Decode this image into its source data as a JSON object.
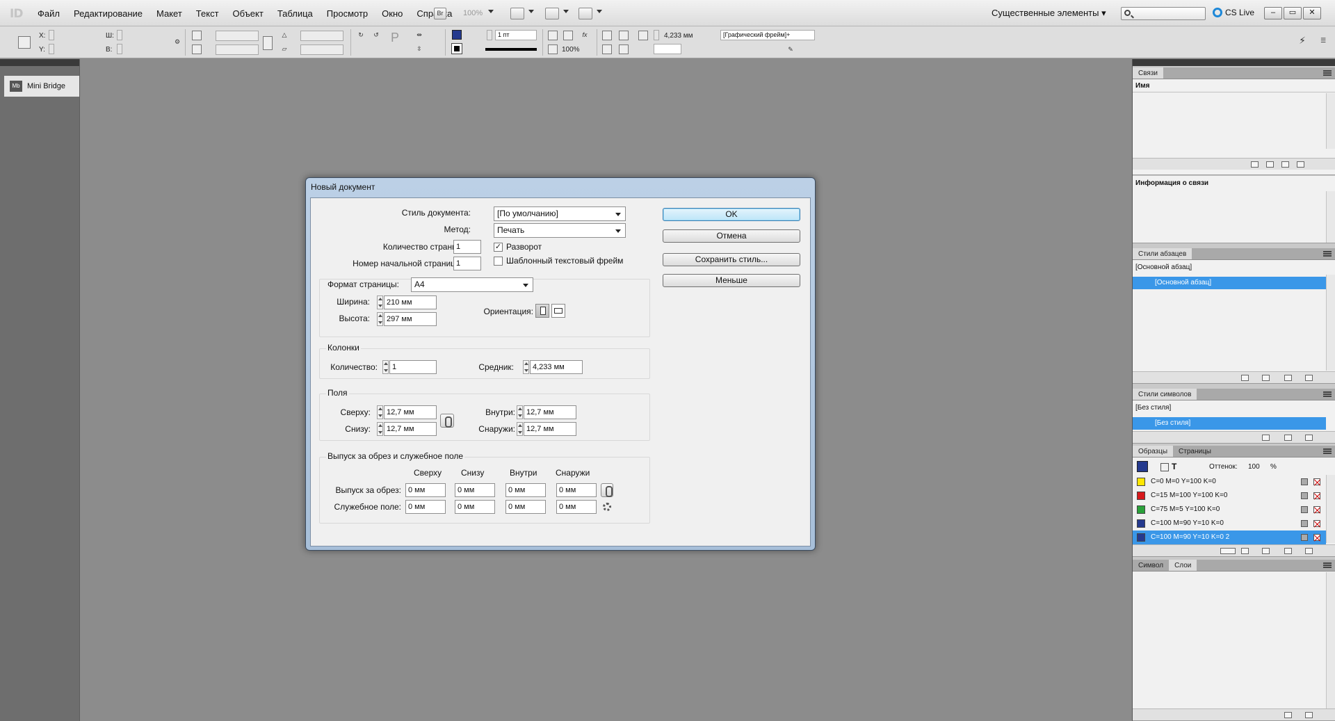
{
  "app": {
    "logo": "ID",
    "menus": [
      "Файл",
      "Редактирование",
      "Макет",
      "Текст",
      "Объект",
      "Таблица",
      "Просмотр",
      "Окно",
      "Справка"
    ],
    "bridge_button": "Br",
    "zoom": "100%",
    "workspace": "Существенные элементы",
    "cs_live": "CS Live",
    "window_buttons": [
      "–",
      "▭",
      "✕"
    ]
  },
  "controlbar": {
    "x_label": "X:",
    "y_label": "Y:",
    "w_label": "Ш:",
    "h_label": "В:",
    "stroke_weight": "1 пт",
    "dimension": "4,233 мм",
    "opacity": "100%",
    "frame_style": "[Графический фрейм]+"
  },
  "left_dock": {
    "mini_bridge_badge": "Mb",
    "mini_bridge_label": "Mini Bridge"
  },
  "links_panel": {
    "tab": "Связи",
    "col_name": "Имя",
    "info_title": "Информация о связи"
  },
  "para_styles": {
    "tab": "Стили абзацев",
    "current": "[Основной абзац]",
    "selected_item": "[Основной абзац]"
  },
  "char_styles": {
    "tab": "Стили символов",
    "current": "[Без стиля]",
    "selected_item": "[Без стиля]"
  },
  "swatches": {
    "tabs": [
      "Образцы",
      "Страницы"
    ],
    "tint_label": "Оттенок:",
    "tint_value": "100",
    "tint_unit": "%",
    "items": [
      {
        "name": "C=0 M=0 Y=100 K=0",
        "color": "#ffe600"
      },
      {
        "name": "C=15 M=100 Y=100 K=0",
        "color": "#d7191c"
      },
      {
        "name": "C=75 M=5 Y=100 K=0",
        "color": "#2aa13a"
      },
      {
        "name": "C=100 M=90 Y=10 K=0",
        "color": "#253a8e"
      },
      {
        "name": "C=100 M=90 Y=10 K=0 2",
        "color": "#253a8e"
      }
    ]
  },
  "layers_panel": {
    "tabs": [
      "Символ",
      "Слои"
    ]
  },
  "dialog": {
    "title": "Новый документ",
    "doc_style_label": "Стиль документа:",
    "doc_style_value": "[По умолчанию]",
    "intent_label": "Метод:",
    "intent_value": "Печать",
    "pages_label": "Количество страниц:",
    "pages_value": "1",
    "start_page_label": "Номер начальной страницы:",
    "start_page_value": "1",
    "facing_pages_label": "Разворот",
    "facing_pages_checked": "✓",
    "primary_frame_label": "Шаблонный текстовый фрейм",
    "page_size_label": "Формат страницы:",
    "page_size_value": "A4",
    "width_label": "Ширина:",
    "width_value": "210 мм",
    "height_label": "Высота:",
    "height_value": "297 мм",
    "orientation_label": "Ориентация:",
    "columns_title": "Колонки",
    "columns_count_label": "Количество:",
    "columns_count_value": "1",
    "gutter_label": "Средник:",
    "gutter_value": "4,233 мм",
    "margins_title": "Поля",
    "top_label": "Сверху:",
    "top_value": "12,7 мм",
    "bottom_label": "Снизу:",
    "bottom_value": "12,7 мм",
    "inside_label": "Внутри:",
    "inside_value": "12,7 мм",
    "outside_label": "Снаружи:",
    "outside_value": "12,7 мм",
    "bleed_title": "Выпуск за обрез и служебное поле",
    "bleed_cols": [
      "Сверху",
      "Снизу",
      "Внутри",
      "Снаружи"
    ],
    "bleed_label": "Выпуск за обрез:",
    "bleed_values": [
      "0 мм",
      "0 мм",
      "0 мм",
      "0 мм"
    ],
    "slug_label": "Служебное поле:",
    "slug_values": [
      "0 мм",
      "0 мм",
      "0 мм",
      "0 мм"
    ],
    "ok": "OK",
    "cancel": "Отмена",
    "save_preset": "Сохранить стиль...",
    "fewer_options": "Меньше"
  }
}
